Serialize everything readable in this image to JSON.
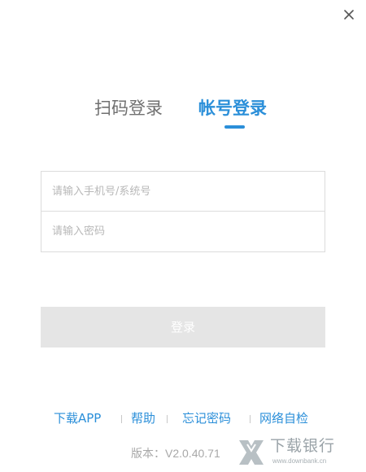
{
  "window": {
    "close_icon": "close-icon"
  },
  "tabs": {
    "scan_label": "扫码登录",
    "account_label": "帐号登录",
    "active_tab": "account",
    "active_color": "#2b8fd9",
    "inactive_color": "#707070"
  },
  "form": {
    "account_value": "",
    "account_placeholder": "请输入手机号/系统号",
    "password_value": "",
    "password_placeholder": "请输入密码"
  },
  "login_button": {
    "label": "登录",
    "background": "#e5e5e5",
    "text_color": "#ffffff"
  },
  "footer": {
    "links": [
      {
        "label": "下载APP"
      },
      {
        "label": "帮助"
      },
      {
        "label": "忘记密码"
      },
      {
        "label": "网络自检"
      }
    ],
    "link_color": "#2b8fd9",
    "version_prefix": "版本：",
    "version_number": "V2.0.40.71"
  },
  "watermark": {
    "site_name": "下载银行",
    "url": "www.downbank.cn"
  }
}
